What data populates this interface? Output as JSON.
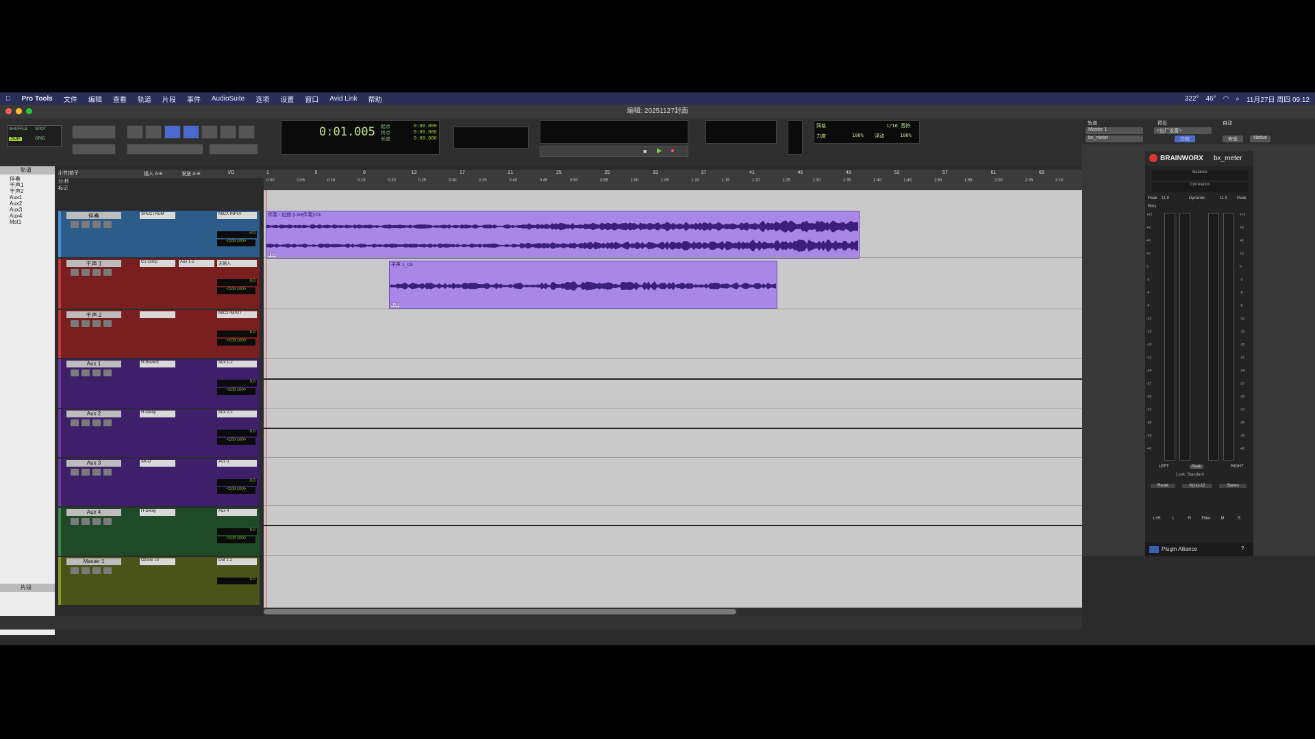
{
  "menubar": {
    "items": [
      "Pro Tools",
      "文件",
      "编辑",
      "查看",
      "轨道",
      "片段",
      "事件",
      "AudioSuite",
      "选项",
      "设置",
      "窗口",
      "Avid Link",
      "帮助"
    ],
    "status_right": "11月27日 周四 09:12",
    "temp": "322°",
    "battery": "46°"
  },
  "window": {
    "title": "编辑: 20251127封面"
  },
  "toolbar": {
    "mode_shuffle": "SHUFFLE",
    "mode_spot": "SPOT",
    "mode_slip": "SLIP",
    "mode_grid": "GRID",
    "counter_main": "0:01.005",
    "counter_labels": [
      "起点",
      "终点",
      "长度"
    ],
    "counter_values": [
      "0:00.000",
      "0:00.000",
      "0:00.000"
    ],
    "nudge_label": "网格",
    "grid_value": "1/16 音符",
    "strength_label": "力度",
    "strength_value": "100%",
    "float_label": "浮动",
    "float_value": "100%"
  },
  "tracks_panel": {
    "header": "轨道",
    "clips_header": "片段",
    "items": [
      "伴奏",
      "干声1",
      "干声2",
      "Aux1",
      "Aux2",
      "Aux3",
      "Aux4",
      "Mst1"
    ]
  },
  "columns": {
    "inserts": "插入 A-E",
    "sends": "发送 A-E",
    "io": "I/O"
  },
  "ruler": {
    "bars_label": "小节|拍子",
    "min_label": "分:秒",
    "markers_label": "标记",
    "bars": [
      "1",
      "5",
      "9",
      "13",
      "17",
      "21",
      "25",
      "29",
      "33",
      "37",
      "41",
      "45",
      "49",
      "53",
      "57",
      "61",
      "65"
    ],
    "times": [
      "0:00",
      "0:05",
      "0:10",
      "0:15",
      "0:20",
      "0:25",
      "0:30",
      "0:35",
      "0:40",
      "0:45",
      "0:50",
      "0:55",
      "1:00",
      "1:05",
      "1:10",
      "1:15",
      "1:20",
      "1:25",
      "1:30",
      "1:35",
      "1:40",
      "1:45",
      "1:50",
      "1:55",
      "2:00",
      "2:05",
      "2:10"
    ]
  },
  "tracks": [
    {
      "name": "伴奏",
      "color": "#4a8fd6",
      "bg": "#2b5c8a",
      "insert": "SPECTRUM",
      "send": "",
      "io": "MICX INPUT",
      "vol": "-4.0",
      "pan": "<100 100>"
    },
    {
      "name": "干声 1",
      "color": "#c03a3a",
      "bg": "#7a1f1f",
      "insert": "C1 comp",
      "send": "Aux 1-2",
      "io": "无输入",
      "vol": "0.0",
      "pan": "<100 100>"
    },
    {
      "name": "干声 2",
      "color": "#c03a3a",
      "bg": "#7a1f1f",
      "insert": "",
      "send": "",
      "io": "MIC2 INPUT",
      "vol": "0.0",
      "pan": "<100 100>"
    },
    {
      "name": "Aux 1",
      "color": "#6a3aa0",
      "bg": "#3d1f6a",
      "insert": "H-Reverb",
      "send": "",
      "io": "Aux 1-2",
      "vol": "0.0",
      "pan": "<100 100>"
    },
    {
      "name": "Aux 2",
      "color": "#6a3aa0",
      "bg": "#3d1f6a",
      "insert": "H-Delay",
      "send": "",
      "io": "Aux 2-2",
      "vol": "0.0",
      "pan": "<100 100>"
    },
    {
      "name": "Aux 3",
      "color": "#6a3aa0",
      "bg": "#3d1f6a",
      "insert": "AK-D",
      "send": "",
      "io": "Aux 3",
      "vol": "0.0",
      "pan": "<100 100>"
    },
    {
      "name": "Aux 4",
      "color": "#3a8a4a",
      "bg": "#1f4a28",
      "insert": "H-Delay",
      "send": "",
      "io": "Aux 4",
      "vol": "0.0",
      "pan": "<100 100>"
    },
    {
      "name": "Master 1",
      "color": "#8a9a2a",
      "bg": "#4a5418",
      "insert": "Ozone 10",
      "send": "",
      "io": "Out 1-2",
      "vol": "0.0",
      "pan": ""
    }
  ],
  "clips": [
    {
      "name": "伴奏 - 红颜 (Live伴奏)-01",
      "label": "0.00"
    },
    {
      "name": "干声 1_03",
      "label": "0.00"
    }
  ],
  "plugin": {
    "header_items": [
      "轨道",
      "预设",
      "自动"
    ],
    "track_select": "Master 1",
    "plugin_select": "bx_meter",
    "preset": "<出厂设置>",
    "compare": "比较",
    "safe": "安全",
    "native": "Native",
    "brand": "BRAINWORX",
    "name": "bx_meter",
    "balance": "Balance",
    "correlation": "Correlation",
    "peak_left": "Peak",
    "peak_right": "Peak",
    "dynamic": "Dynamic",
    "rms": "Rms",
    "peak_val_left": "11.0",
    "peak_val_right": "11.0",
    "left": "LEFT",
    "right": "RIGHT",
    "peak_btn": "Peak",
    "look": "Look: Standard",
    "reset": "Reset",
    "k_scale": "K(xx)-12",
    "stereo": "Stereo",
    "footer": "Plugin Alliance",
    "bottom_labels": [
      "L+R",
      "L",
      "R",
      "Filter",
      "M",
      "S"
    ],
    "scale": [
      "+12",
      "+9",
      "+6",
      "+3",
      "0",
      "-3",
      "-6",
      "-9",
      "-12",
      "-15",
      "-18",
      "-21",
      "-24",
      "-27",
      "-30",
      "-33",
      "-36",
      "-39",
      "-42"
    ]
  },
  "colors": {
    "clip_fill": "#a987e8",
    "clip_wave": "#3b1f7a",
    "edit_bg": "#c9c9c9",
    "lcd_green": "#9ccc3c"
  }
}
